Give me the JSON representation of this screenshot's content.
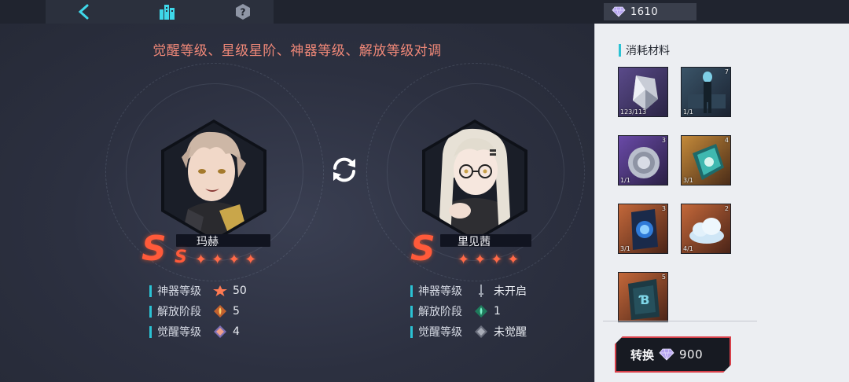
{
  "topbar": {
    "back_icon": "chevron-left-icon",
    "city_icon": "city-buildings-icon",
    "help_icon": "question-mark-icon",
    "currency_icon": "diamond-gem-icon",
    "currency_amount": "1610"
  },
  "headline": "觉醒等级、星级星阶、神器等级、解放等级对调",
  "swap_icon": "swap-arrows-icon",
  "characters": [
    {
      "name": "玛赫",
      "grade": "S",
      "stars": 4,
      "stats": [
        {
          "label": "神器等级",
          "icon": "artifact-star-icon",
          "value": "50"
        },
        {
          "label": "解放阶段",
          "icon": "liberation-flame-icon",
          "value": "5"
        },
        {
          "label": "觉醒等级",
          "icon": "awaken-diamond-icon",
          "value": "4"
        }
      ]
    },
    {
      "name": "里见茜",
      "grade": "S",
      "stars": 4,
      "stats": [
        {
          "label": "神器等级",
          "icon": "sword-icon",
          "value": "未开启"
        },
        {
          "label": "解放阶段",
          "icon": "liberation-flame-icon",
          "value": "1"
        },
        {
          "label": "觉醒等级",
          "icon": "awaken-diamond-icon",
          "value": "未觉醒"
        }
      ]
    }
  ],
  "panel": {
    "title": "消耗材料",
    "items": [
      {
        "name": "crystal-shard-item",
        "count": "123/113",
        "rank": ""
      },
      {
        "name": "character-card-item",
        "count": "1/1",
        "rank": "7"
      },
      {
        "name": "silver-disc-item",
        "count": "1/1",
        "rank": "3"
      },
      {
        "name": "shield-emblem-item",
        "count": "3/1",
        "rank": "4"
      },
      {
        "name": "blue-book-item",
        "count": "3/1",
        "rank": "3"
      },
      {
        "name": "cloud-item",
        "count": "4/1",
        "rank": "2"
      },
      {
        "name": "dark-card-item",
        "count": "",
        "rank": "5"
      }
    ],
    "convert_label": "转换",
    "convert_cost": "900"
  },
  "colors": {
    "accent_cyan": "#2bc2d4",
    "headline": "#f08878",
    "star": "#ff6a48",
    "button_border": "#d8404a"
  }
}
